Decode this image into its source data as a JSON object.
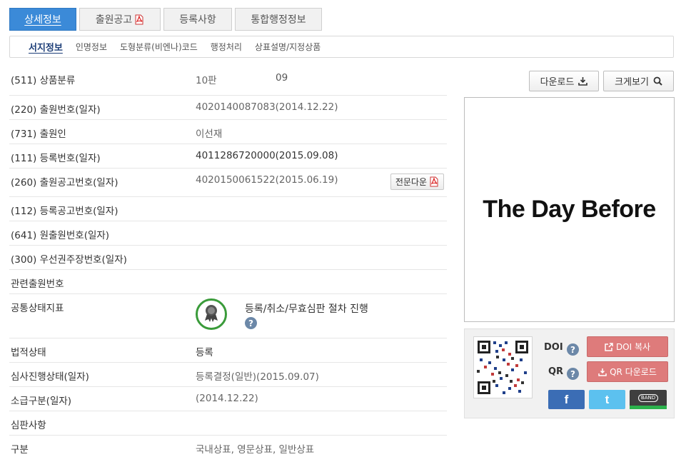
{
  "top_tabs": [
    {
      "label": "상세정보",
      "active": true
    },
    {
      "label": "출원공고",
      "active": false,
      "has_pdf_icon": true
    },
    {
      "label": "등록사항",
      "active": false
    },
    {
      "label": "통합행정정보",
      "active": false
    }
  ],
  "sub_tabs": [
    {
      "label": "서지정보",
      "active": true
    },
    {
      "label": "인명정보"
    },
    {
      "label": "도형분류(비엔나)코드"
    },
    {
      "label": "행정처리"
    },
    {
      "label": "상표설명/지정상품"
    }
  ],
  "rows": {
    "goods_class": {
      "label": "(511) 상품분류",
      "edition": "10판",
      "class": "09"
    },
    "app_number": {
      "label": "(220) 출원번호(일자)",
      "value": "4020140087083(2014.12.22)"
    },
    "applicant": {
      "label": "(731) 출원인",
      "value": "이선재"
    },
    "reg_number": {
      "label": "(111) 등록번호(일자)",
      "value": "4011286720000(2015.09.08)"
    },
    "pub_number": {
      "label": "(260) 출원공고번호(일자)",
      "value": "4020150061522(2015.06.19)",
      "button": "전문다운"
    },
    "reg_pub_number": {
      "label": "(112) 등록공고번호(일자)",
      "value": ""
    },
    "orig_app_number": {
      "label": "(641) 원출원번호(일자)",
      "value": ""
    },
    "priority_number": {
      "label": "(300) 우선권주장번호(일자)",
      "value": ""
    },
    "related_app": {
      "label": "관련출원번호",
      "value": ""
    },
    "common_status": {
      "label": "공통상태지표",
      "value": "등록/취소/무효심판 절차 진행"
    },
    "legal_status": {
      "label": "법적상태",
      "value": "등록"
    },
    "exam_status": {
      "label": "심사진행상태(일자)",
      "value": "등록결정(일반)(2015.09.07)"
    },
    "retro_class": {
      "label": "소급구분(일자)",
      "value": "(2014.12.22)"
    },
    "trial": {
      "label": "심판사항",
      "value": ""
    },
    "category": {
      "label": "구분",
      "value": "국내상표, 영문상표, 일반상표"
    }
  },
  "right": {
    "download_label": "다운로드",
    "zoom_label": "크게보기",
    "mark_text": "The Day Before",
    "doi_label": "DOI",
    "qr_label": "QR",
    "doi_copy_label": "DOI 복사",
    "qr_download_label": "QR 다운로드",
    "band_label": "BAND"
  },
  "help_glyph": "?",
  "colors": {
    "accent": "#3b8ad8",
    "pink": "#de7b7b",
    "facebook": "#3b6db5",
    "twitter": "#5cc1ef",
    "status_green": "#3a9b3a"
  }
}
